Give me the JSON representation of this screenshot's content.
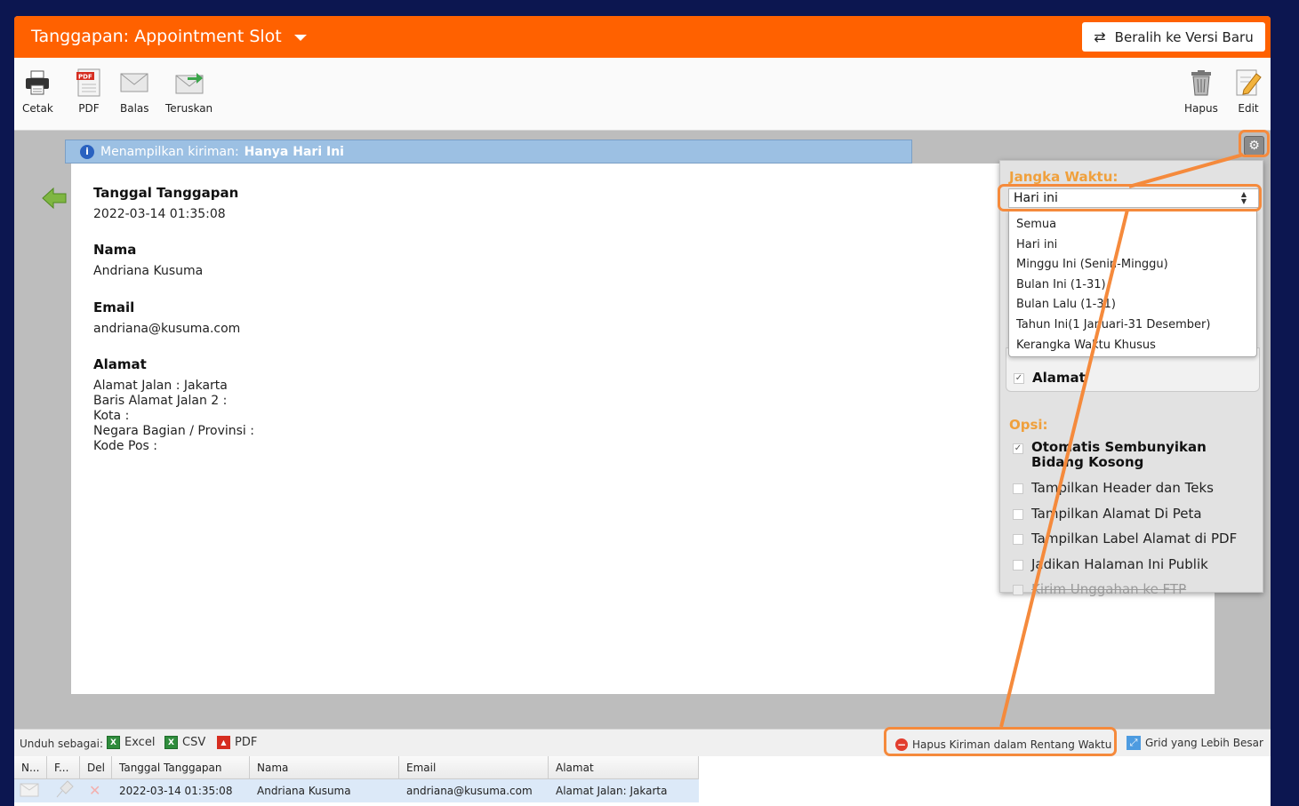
{
  "header": {
    "title": "Tanggapan: Appointment Slot",
    "switch_label": "Beralih ke Versi Baru"
  },
  "toolbar": {
    "print": "Cetak",
    "pdf": "PDF",
    "reply": "Balas",
    "forward": "Teruskan",
    "delete": "Hapus",
    "edit": "Edit"
  },
  "info_bar": {
    "prefix": "Menampilkan kiriman:",
    "value": "Hanya Hari Ini"
  },
  "submission": {
    "date_label": "Tanggal Tanggapan",
    "date_value": "2022-03-14 01:35:08",
    "name_label": "Nama",
    "name_value": "Andriana Kusuma",
    "email_label": "Email",
    "email_value": "andriana@kusuma.com",
    "address_label": "Alamat",
    "address_lines": [
      "Alamat Jalan : Jakarta",
      "Baris Alamat Jalan 2 :",
      "Kota :",
      "Negara Bagian / Provinsi :",
      "Kode Pos :"
    ]
  },
  "panel": {
    "range_header": "Jangka Waktu:",
    "range_selected": "Hari ini",
    "range_options": [
      "Semua",
      "Hari ini",
      "Minggu Ini (Senin-Minggu)",
      "Bulan Ini (1-31)",
      "Bulan Lalu (1-31)",
      "Tahun Ini(1 Januari-31 Desember)",
      "Kerangka Waktu Khusus"
    ],
    "field_address": "Alamat",
    "options_header": "Opsi:",
    "options": [
      {
        "label": "Otomatis Sembunyikan Bidang Kosong",
        "checked": true
      },
      {
        "label": "Tampilkan Header dan Teks",
        "checked": false
      },
      {
        "label": "Tampilkan Alamat Di Peta",
        "checked": false
      },
      {
        "label": "Tampilkan Label Alamat di PDF",
        "checked": false
      },
      {
        "label": "Jadikan Halaman Ini Publik",
        "checked": false
      },
      {
        "label": "Kirim Unggahan ke FTP",
        "checked": false,
        "disabled": true
      }
    ]
  },
  "download": {
    "label": "Unduh sebagai:",
    "excel": "Excel",
    "csv": "CSV",
    "pdf": "PDF",
    "delete_range": "Hapus Kiriman dalam Rentang Waktu",
    "bigger_grid": "Grid yang Lebih Besar"
  },
  "grid": {
    "headers": [
      "N...",
      "F...",
      "Del",
      "Tanggal Tanggapan",
      "Nama",
      "Email",
      "Alamat"
    ],
    "row": {
      "date": "2022-03-14 01:35:08",
      "name": "Andriana Kusuma",
      "email": "andriana@kusuma.com",
      "address": "Alamat Jalan: Jakarta"
    }
  },
  "colors": {
    "brand_orange": "#ff6100",
    "highlight": "#f58a3c",
    "info_blue": "#9cc0e3",
    "background_navy": "#0c1650"
  }
}
